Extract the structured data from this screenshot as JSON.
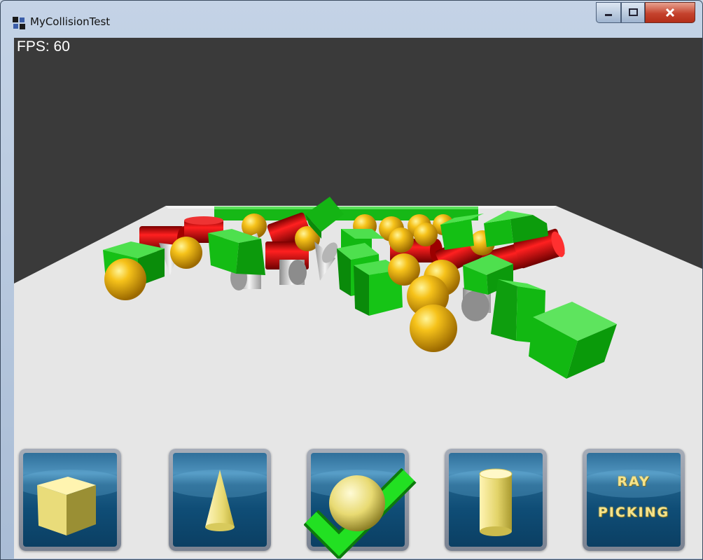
{
  "window": {
    "title": "MyCollisionTest"
  },
  "titlebar_buttons": {
    "minimize": "minimize",
    "maximize": "maximize",
    "close": "close"
  },
  "hud": {
    "fps": "FPS: 60"
  },
  "toolbar": [
    {
      "label": "",
      "icon": "cube-icon",
      "selected": false
    },
    {
      "label": "",
      "icon": "cone-icon",
      "selected": false
    },
    {
      "label": "",
      "icon": "sphere-icon",
      "selected": true
    },
    {
      "label": "",
      "icon": "cylinder-icon",
      "selected": false
    },
    {
      "label": "RAY PICKING",
      "line1": "RAY",
      "line2": "PICKING",
      "icon": "none",
      "selected": false
    }
  ],
  "colors": {
    "background": "#3a3a3a",
    "floor": "#e6e6e6",
    "box": "#19c419",
    "cylinder": "#c40000",
    "sphere": "#f2b400",
    "cone": "#c9c9c9",
    "check": "#22e022"
  }
}
